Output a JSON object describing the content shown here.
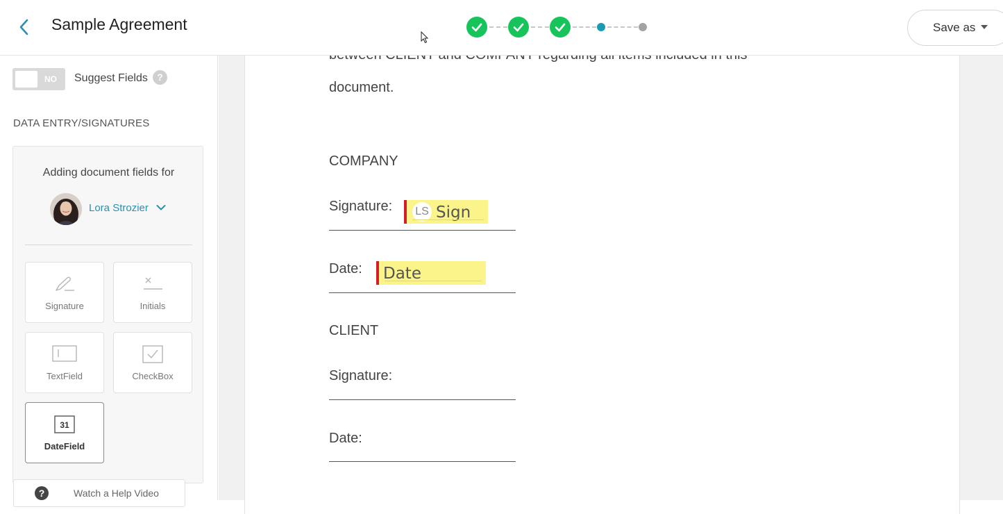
{
  "header": {
    "title": "Sample Agreement",
    "save_label": "Save as"
  },
  "steps": {
    "completed": 3,
    "current": 4,
    "total": 5
  },
  "sidebar": {
    "toggle_label": "NO",
    "suggest_label": "Suggest Fields",
    "help_symbol": "?",
    "section_title": "DATA ENTRY/SIGNATURES",
    "adding_label": "Adding document fields for",
    "user_name": "Lora Strozier",
    "tiles": [
      {
        "label": "Signature",
        "icon": "pen-icon"
      },
      {
        "label": "Initials",
        "icon": "x-line-icon"
      },
      {
        "label": "TextField",
        "icon": "textfield-icon"
      },
      {
        "label": "CheckBox",
        "icon": "checkbox-icon"
      },
      {
        "label": "DateField",
        "icon": "calendar-icon",
        "calendar_number": "31"
      }
    ],
    "help_video_label": "Watch a Help Video"
  },
  "document": {
    "cut_line": "between CLIENT and COMPANY regarding all items included in this",
    "line_document": "document.",
    "company_heading": "COMPANY",
    "signature_label": "Signature:",
    "date_label": "Date:",
    "client_heading": "CLIENT",
    "client_signature_label": "Signature:",
    "client_date_label": "Date:",
    "sign_field": {
      "initials": "LS",
      "label": "Sign"
    },
    "date_field": {
      "label": "Date"
    }
  },
  "colors": {
    "accent": "#2b8fb0",
    "step_done": "#17c45b",
    "step_current": "#1b9bb3",
    "field_bg": "#fbf48a",
    "field_marker": "#d41c2a"
  }
}
